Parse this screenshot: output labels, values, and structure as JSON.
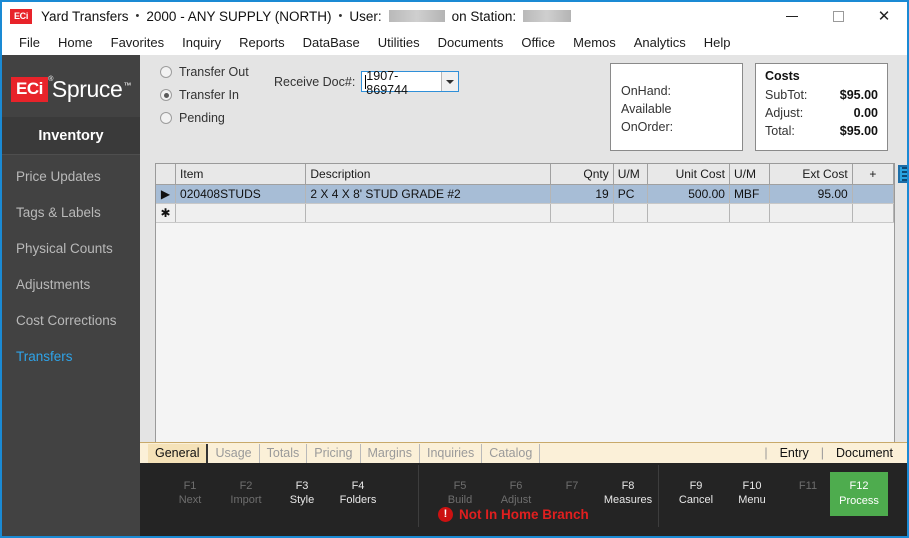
{
  "window": {
    "app_logo": "ECi",
    "title": "Yard Transfers",
    "branch": "2000 - ANY SUPPLY (NORTH)",
    "user_label": "User:",
    "station_label": "on Station:",
    "minimize": "minimize-icon",
    "maximize": "maximize-icon",
    "close": "✕"
  },
  "menu": {
    "items": [
      {
        "label": "File"
      },
      {
        "label": "Home"
      },
      {
        "label": "Favorites"
      },
      {
        "label": "Inquiry"
      },
      {
        "label": "Reports"
      },
      {
        "label": "DataBase"
      },
      {
        "label": "Utilities"
      },
      {
        "label": "Documents"
      },
      {
        "label": "Office"
      },
      {
        "label": "Memos"
      },
      {
        "label": "Analytics"
      },
      {
        "label": "Help"
      }
    ]
  },
  "sidebar": {
    "logo_eci": "ECi",
    "logo_reg": "®",
    "logo_spruce": "Spruce",
    "logo_tm": "™",
    "section": "Inventory",
    "items": [
      {
        "label": "Price Updates",
        "active": false
      },
      {
        "label": "Tags & Labels",
        "active": false
      },
      {
        "label": "Physical Counts",
        "active": false
      },
      {
        "label": "Adjustments",
        "active": false
      },
      {
        "label": "Cost Corrections",
        "active": false
      },
      {
        "label": "Transfers",
        "active": true
      }
    ],
    "active_color": "#2ea3e8"
  },
  "form": {
    "radios": [
      {
        "label": "Transfer Out",
        "checked": false
      },
      {
        "label": "Transfer In",
        "checked": true
      },
      {
        "label": "Pending",
        "checked": false
      }
    ],
    "doc_label": "Receive Doc#:",
    "doc_value": "1907-869744",
    "doc_placeholder": ""
  },
  "stock_panel": {
    "onhand_label": "OnHand:",
    "onhand_value": "",
    "available_label": "Available",
    "available_value": "",
    "onorder_label": "OnOrder:",
    "onorder_value": ""
  },
  "costs_panel": {
    "title": "Costs",
    "rows": [
      {
        "label": "SubTot:",
        "value": "$95.00"
      },
      {
        "label": "Adjust:",
        "value": "0.00"
      },
      {
        "label": "Total:",
        "value": "$95.00"
      }
    ]
  },
  "grid": {
    "columns": [
      {
        "label": "Item",
        "align": "left"
      },
      {
        "label": "Description",
        "align": "left"
      },
      {
        "label": "Qnty",
        "align": "right"
      },
      {
        "label": "U/M",
        "align": "left"
      },
      {
        "label": "Unit Cost",
        "align": "right"
      },
      {
        "label": "U/M",
        "align": "left"
      },
      {
        "label": "Ext Cost",
        "align": "right"
      },
      {
        "label": "+",
        "align": "center"
      }
    ],
    "rows": [
      {
        "marker": "▶",
        "item": "020408STUDS",
        "description": "2 X 4 X 8' STUD GRADE #2",
        "qnty": "19",
        "um1": "PC",
        "unit_cost": "500.00",
        "um2": "MBF",
        "ext_cost": "95.00",
        "plus": ""
      }
    ],
    "new_row_marker": "✱",
    "side_icon": "grid-options-icon"
  },
  "tabs": {
    "items": [
      {
        "label": "General",
        "active": true
      },
      {
        "label": "Usage",
        "active": false
      },
      {
        "label": "Totals",
        "active": false
      },
      {
        "label": "Pricing",
        "active": false
      },
      {
        "label": "Margins",
        "active": false
      },
      {
        "label": "Inquiries",
        "active": false
      },
      {
        "label": "Catalog",
        "active": false
      }
    ],
    "right": [
      {
        "label": "Entry"
      },
      {
        "label": "Document"
      }
    ]
  },
  "function_keys": {
    "group1": [
      {
        "key": "F1",
        "label": "Next",
        "enabled": false
      },
      {
        "key": "F2",
        "label": "Import",
        "enabled": false
      },
      {
        "key": "F3",
        "label": "Style",
        "enabled": true
      },
      {
        "key": "F4",
        "label": "Folders",
        "enabled": true
      }
    ],
    "group2": [
      {
        "key": "F5",
        "label": "Build",
        "enabled": false
      },
      {
        "key": "F6",
        "label": "Adjust",
        "enabled": false
      },
      {
        "key": "F7",
        "label": "",
        "enabled": false
      },
      {
        "key": "F8",
        "label": "Measures",
        "enabled": true
      }
    ],
    "group3": [
      {
        "key": "F9",
        "label": "Cancel",
        "enabled": true
      },
      {
        "key": "F10",
        "label": "Menu",
        "enabled": true
      },
      {
        "key": "F11",
        "label": "",
        "enabled": false
      }
    ],
    "process": {
      "key": "F12",
      "label": "Process",
      "color": "#4eac4e"
    },
    "warning": {
      "icon": "!",
      "text": "Not In Home Branch",
      "color": "#e01f1f"
    }
  }
}
